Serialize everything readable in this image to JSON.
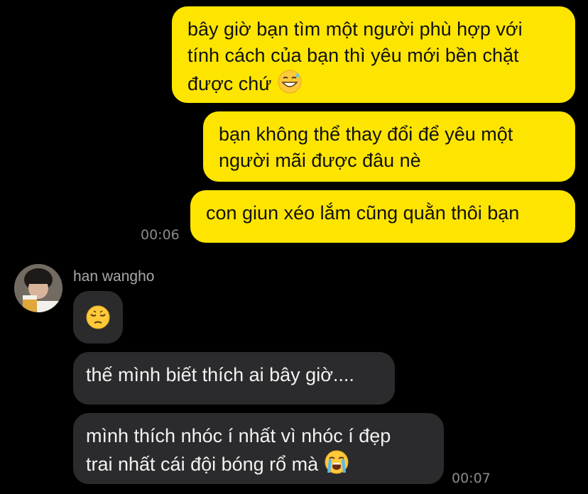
{
  "colors": {
    "background": "#000000",
    "outgoing_bubble": "#FEE500",
    "incoming_bubble": "#2B2B2D",
    "timestamp": "#8A8A8E"
  },
  "outgoing": [
    {
      "lines": [
        "bây giờ bạn tìm một người phù hợp với",
        "tính cách của bạn thì yêu mới bền chặt",
        "được chứ"
      ],
      "emoji": "grinning-sweat-face-icon"
    },
    {
      "lines": [
        "bạn không thể thay đổi để yêu một",
        "người mãi được đâu nè"
      ]
    },
    {
      "lines": [
        "con giun xéo lắm cũng quằn thôi bạn"
      ],
      "time": "00:06"
    }
  ],
  "incoming": {
    "sender": "han wangho",
    "avatar": "profile-photo-avatar",
    "messages": [
      {
        "emoji": "pensive-face-icon"
      },
      {
        "lines": [
          "thế mình biết thích ai bây giờ...."
        ]
      },
      {
        "lines": [
          "mình thích nhóc í nhất vì nhóc í đẹp",
          "trai nhất cái đội bóng rổ mà"
        ],
        "emoji": "loudly-crying-face-icon",
        "time": "00:07"
      }
    ]
  }
}
